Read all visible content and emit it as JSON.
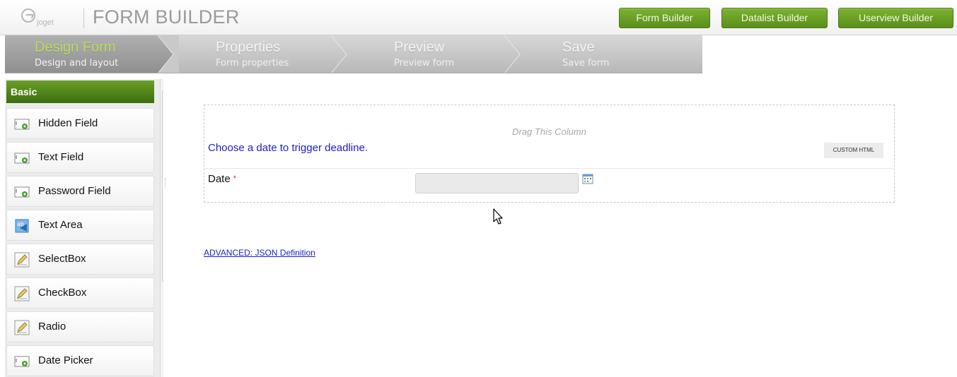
{
  "header": {
    "logo_text": "joget",
    "title": "FORM BUILDER",
    "buttons": [
      "Form Builder",
      "Datalist Builder",
      "Userview Builder"
    ]
  },
  "steps": [
    {
      "title": "Design Form",
      "subtitle": "Design and layout",
      "active": true
    },
    {
      "title": "Properties",
      "subtitle": "Form properties",
      "active": false
    },
    {
      "title": "Preview",
      "subtitle": "Preview form",
      "active": false
    },
    {
      "title": "Save",
      "subtitle": "Save form",
      "active": false
    }
  ],
  "sidebar": {
    "section": "Basic",
    "items": [
      {
        "label": "Hidden Field",
        "icon": "field-icon"
      },
      {
        "label": "Text Field",
        "icon": "field-icon"
      },
      {
        "label": "Password Field",
        "icon": "field-icon"
      },
      {
        "label": "Text Area",
        "icon": "textarea-icon"
      },
      {
        "label": "SelectBox",
        "icon": "edit-icon"
      },
      {
        "label": "CheckBox",
        "icon": "edit-icon"
      },
      {
        "label": "Radio",
        "icon": "edit-icon"
      },
      {
        "label": "Date Picker",
        "icon": "field-icon"
      }
    ]
  },
  "canvas": {
    "drag_column": "Drag This Column",
    "html_text": "Choose a date to trigger deadline.",
    "html_badge": "CUSTOM HTML",
    "date_label": "Date",
    "required_mark": "*",
    "json_link": "ADVANCED: JSON Definition"
  },
  "colors": {
    "accent_green": "#5b8f1c",
    "active_step_text": "#b7dd5d",
    "link_blue": "#1c1ccb"
  }
}
